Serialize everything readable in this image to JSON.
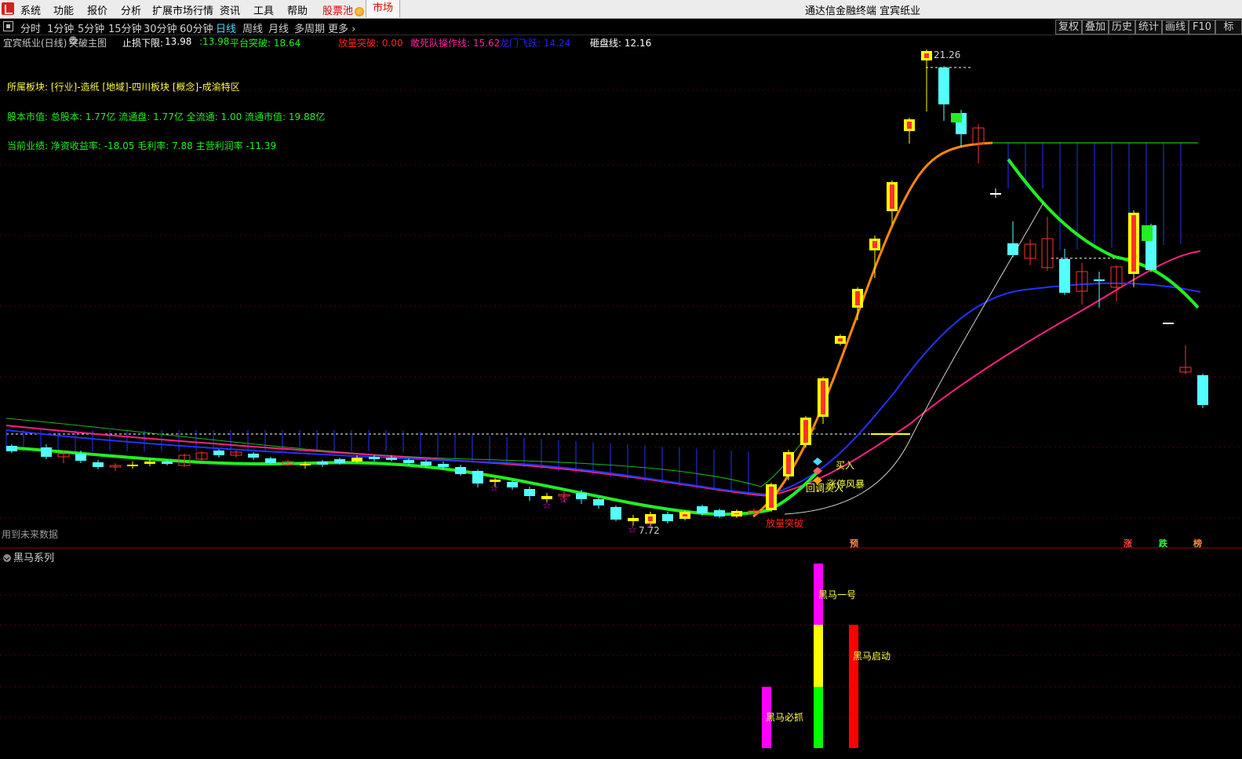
{
  "menubar": {
    "items": [
      "系统",
      "功能",
      "报价",
      "分析",
      "扩展市场行情",
      "资讯",
      "工具",
      "帮助"
    ],
    "stock_pool": "股票池",
    "market": "市场",
    "title": "通达信金融终端 宜宾纸业"
  },
  "periods": [
    "分时",
    "1分钟",
    "5分钟",
    "15分钟",
    "30分钟",
    "60分钟",
    "日线",
    "周线",
    "月线",
    "多周期",
    "更多"
  ],
  "active_period": "日线",
  "tools": [
    "复权",
    "叠加",
    "历史",
    "统计",
    "画线",
    "F10",
    "标"
  ],
  "info": {
    "stock": "宜宾纸业(日线)",
    "indicator": "突破主图",
    "stop_label": "止损下限:",
    "stop_value": "13.98",
    "mid_value": ":13.98",
    "platform": "平台突破: 18.64",
    "volume_break": "放量突破: 0.00",
    "dare_die": "敢死队操作线: 15.62",
    "dragon": "龙门飞跃: 14.24",
    "smash": "砸盘线: 12.16"
  },
  "fundamentals": {
    "sector": "所属板块: [行业]-造纸 [地域]-四川板块 [概念]-成渝特区",
    "capital": "股本市值: 总股本: 1.77亿 流通盘: 1.77亿 全流通: 1.00 流通市值: 19.88亿",
    "performance": "当前业绩: 净资收益率: -18.05 毛利率: 7.88 主营利润率 -11.39"
  },
  "annotations": {
    "high": "21.26",
    "low": "7.72",
    "buy": "买入",
    "limit_storm": "涨停风暴",
    "pullback": "回调买入",
    "volume_break": "放量突破",
    "future_data": "用到未来数据",
    "pre": "预",
    "up": "涨",
    "down": "跌",
    "rank": "榜"
  },
  "subpanel": {
    "title": "黑马系列",
    "labels": [
      "黑马一号",
      "黑马启动",
      "黑马必抓"
    ]
  },
  "colors": {
    "up_candle": "#ff3030",
    "down_candle": "#54ffff",
    "yellow_candle": "#ffff00",
    "ma_green": "#22ee22",
    "ma_blue": "#2222ff",
    "ma_pink": "#ff2080",
    "ma_orange": "#ff8800",
    "magenta": "#ff00ff"
  },
  "chart_data": {
    "type": "candlestick",
    "price_high": 21.26,
    "price_low": 7.72,
    "platform_breakout": 18.64,
    "stop_loss": 13.98,
    "dare_die_line": 15.62,
    "dragon_leap": 14.24,
    "smash_line": 12.16
  }
}
